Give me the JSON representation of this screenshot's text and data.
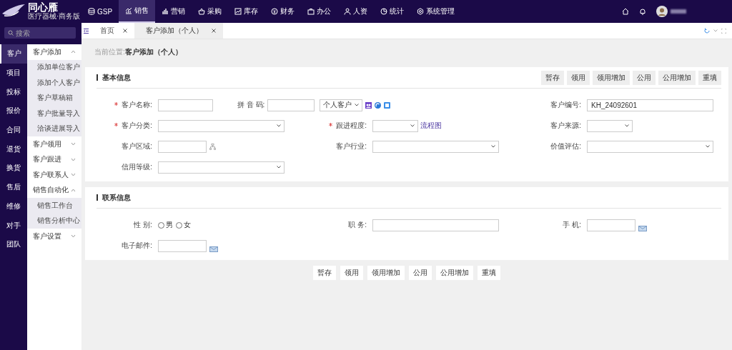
{
  "brand": {
    "name": "同心雁",
    "subtitle": "医疗器械·商务版"
  },
  "topnav": {
    "items": [
      {
        "label": "GSP",
        "selected": false
      },
      {
        "label": "销售",
        "selected": true
      },
      {
        "label": "营销",
        "selected": false
      },
      {
        "label": "采购",
        "selected": false
      },
      {
        "label": "库存",
        "selected": false
      },
      {
        "label": "财务",
        "selected": false
      },
      {
        "label": "办公",
        "selected": false
      },
      {
        "label": "人资",
        "selected": false
      },
      {
        "label": "统计",
        "selected": false
      },
      {
        "label": "系统管理",
        "selected": false
      }
    ]
  },
  "search": {
    "placeholder": "搜索"
  },
  "rail": {
    "items": [
      {
        "label": "客户",
        "selected": true
      },
      {
        "label": "项目",
        "selected": false
      },
      {
        "label": "投标",
        "selected": false
      },
      {
        "label": "报价",
        "selected": false
      },
      {
        "label": "合同",
        "selected": false
      },
      {
        "label": "退货",
        "selected": false
      },
      {
        "label": "换货",
        "selected": false
      },
      {
        "label": "售后",
        "selected": false
      },
      {
        "label": "维修",
        "selected": false
      },
      {
        "label": "对手",
        "selected": false
      },
      {
        "label": "团队",
        "selected": false
      }
    ]
  },
  "submenu": {
    "groups": [
      {
        "label": "客户添加",
        "expanded": true,
        "children": [
          {
            "label": "添加单位客户"
          },
          {
            "label": "添加个人客户"
          },
          {
            "label": "客户草稿箱"
          },
          {
            "label": "客户批量导入"
          },
          {
            "label": "洽谈进展导入"
          }
        ]
      },
      {
        "label": "客户领用",
        "expanded": false
      },
      {
        "label": "客户跟进",
        "expanded": false
      },
      {
        "label": "客户联系人",
        "expanded": false
      },
      {
        "label": "销售自动化",
        "expanded": true,
        "children": [
          {
            "label": "销售工作台"
          },
          {
            "label": "销售分析中心"
          }
        ]
      },
      {
        "label": "客户设置",
        "expanded": false
      }
    ]
  },
  "tabs": [
    {
      "label": "首页",
      "selected": false
    },
    {
      "label": "客户添加（个人）",
      "selected": true
    }
  ],
  "breadcrumb": "当前位置:**客户添加（个人）**",
  "basic_info": {
    "title": "基本信息",
    "actions": [
      "暂存",
      "领用",
      "领用增加",
      "公用",
      "公用增加",
      "重填"
    ],
    "fields": [
      {
        "kind": "name",
        "label": "客户名称:",
        "required": true,
        "pinyin_label": "拼 音 码:",
        "type_select": "个人客户"
      },
      {
        "kind": "input",
        "label": "客户编号:",
        "required": false,
        "value": "KH_24092601"
      },
      {
        "kind": "select",
        "label": "客户分类:",
        "required": true
      },
      {
        "kind": "select-link",
        "label": "跟进程度:",
        "required": true,
        "link": "流程图"
      },
      {
        "kind": "select-short",
        "label": "客户来源:",
        "required": false
      },
      {
        "kind": "region",
        "label": "客户区域:",
        "required": false
      },
      {
        "kind": "select",
        "label": "客户行业:",
        "required": false
      },
      {
        "kind": "select",
        "label": "价值评估:",
        "required": false
      },
      {
        "kind": "select",
        "label": "信用等级:",
        "required": false
      }
    ]
  },
  "contact_info": {
    "title": "联系信息",
    "fields": [
      {
        "kind": "radio",
        "label": "性 别:",
        "required": false,
        "options": [
          {
            "label": "男",
            "selected": false
          },
          {
            "label": "女",
            "selected": false
          }
        ]
      },
      {
        "kind": "input",
        "label": "职 务:",
        "required": false
      },
      {
        "kind": "phone",
        "label": "手 机:",
        "required": false
      },
      {
        "kind": "email",
        "label": "电子邮件:",
        "required": false
      }
    ]
  },
  "footer_actions": [
    "暂存",
    "领用",
    "领用增加",
    "公用",
    "公用增加",
    "重填"
  ]
}
